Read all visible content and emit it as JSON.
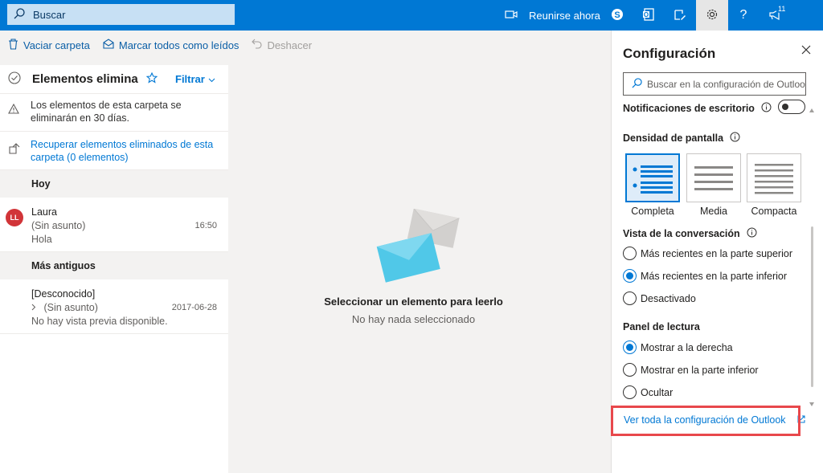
{
  "topbar": {
    "search_placeholder": "Buscar",
    "meet_label": "Reunirse ahora",
    "icons": [
      "video-icon",
      "skype-icon",
      "office-icon",
      "compose-icon",
      "gear-icon",
      "help-icon",
      "megaphone-icon"
    ],
    "notification_count": "11"
  },
  "commands": {
    "empty_folder": "Vaciar carpeta",
    "mark_all_read": "Marcar todos como leídos",
    "undo": "Deshacer"
  },
  "list": {
    "folder_title": "Elementos elimina...",
    "filter_label": "Filtrar",
    "retention_notice": "Los elementos de esta carpeta se eliminarán en 30 días.",
    "recover_link": "Recuperar elementos eliminados de esta carpeta (0 elementos)",
    "sections": [
      {
        "label": "Hoy",
        "messages": [
          {
            "initials": "LL",
            "from": "Laura",
            "subject": "(Sin asunto)",
            "preview": "Hola",
            "time": "16:50"
          }
        ]
      },
      {
        "label": "Más antiguos",
        "messages": [
          {
            "from": "[Desconocido]",
            "subject": "(Sin asunto)",
            "preview": "No hay vista previa disponible.",
            "time": "2017-06-28"
          }
        ]
      }
    ]
  },
  "reading": {
    "title": "Seleccionar un elemento para leerlo",
    "subtitle": "No hay nada seleccionado"
  },
  "settings": {
    "title": "Configuración",
    "search_placeholder": "Buscar en la configuración de Outlook",
    "desktop_notifications": "Notificaciones de escritorio",
    "desktop_notifications_on": false,
    "density_label": "Densidad de pantalla",
    "density_options": [
      "Completa",
      "Media",
      "Compacta"
    ],
    "density_selected": "Completa",
    "conversation_label": "Vista de la conversación",
    "conversation_options": [
      "Más recientes en la parte superior",
      "Más recientes en la parte inferior",
      "Desactivado"
    ],
    "conversation_selected": 1,
    "reading_pane_label": "Panel de lectura",
    "reading_pane_options": [
      "Mostrar a la derecha",
      "Mostrar en la parte inferior",
      "Ocultar"
    ],
    "reading_pane_selected": 0,
    "all_settings_link": "Ver toda la configuración de Outlook"
  },
  "colors": {
    "accent": "#0078d4",
    "highlight_box": "#e8484c",
    "avatar": "#d13438"
  }
}
